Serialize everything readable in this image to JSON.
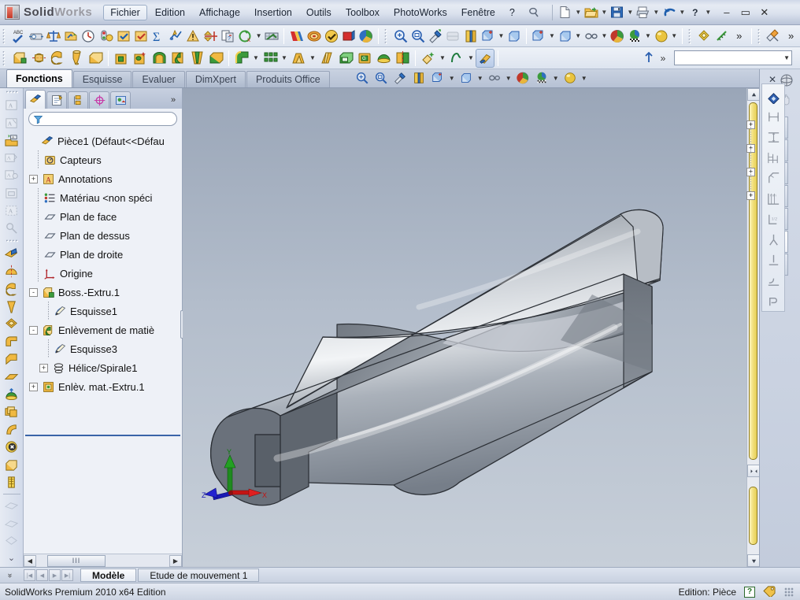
{
  "app": {
    "brand_main": "Solid",
    "brand_sub": "Works",
    "status_text": "SolidWorks Premium 2010 x64 Edition",
    "status_mode": "Edition: Pièce",
    "accent_color": "#c23a28",
    "viewport_bg_top": "#9aa6b8",
    "viewport_bg_bottom": "#c7cfd9"
  },
  "menu": {
    "items": [
      {
        "label": "Fichier",
        "boxed": true
      },
      {
        "label": "Edition",
        "boxed": false
      },
      {
        "label": "Affichage",
        "boxed": false
      },
      {
        "label": "Insertion",
        "boxed": false
      },
      {
        "label": "Outils",
        "boxed": false
      },
      {
        "label": "Toolbox",
        "boxed": false
      },
      {
        "label": "PhotoWorks",
        "boxed": false
      },
      {
        "label": "Fenêtre",
        "boxed": false
      },
      {
        "label": "?",
        "boxed": false
      }
    ],
    "pin_icon": "pin-icon",
    "quick_tools": [
      {
        "name": "new-document-icon",
        "caret": true
      },
      {
        "name": "open-folder-icon",
        "caret": true
      },
      {
        "name": "save-icon",
        "caret": true
      },
      {
        "name": "print-icon",
        "caret": true
      },
      {
        "name": "undo-icon",
        "caret": true
      },
      {
        "name": "help-question-icon",
        "caret": true
      }
    ],
    "window_controls": [
      {
        "name": "minimize-button",
        "glyph": "–"
      },
      {
        "name": "maximize-button",
        "glyph": "▭"
      },
      {
        "name": "close-button",
        "glyph": "✕"
      }
    ]
  },
  "toolbar_row1": {
    "icons": [
      {
        "name": "spell-checker-icon"
      },
      {
        "name": "measure-icon"
      },
      {
        "name": "mass-properties-icon"
      },
      {
        "name": "section-properties-icon"
      },
      {
        "name": "performance-evaluation-icon"
      },
      {
        "name": "sensor-icon"
      },
      {
        "name": "check-entity-icon"
      },
      {
        "name": "geometry-analysis-icon"
      },
      {
        "name": "equations-icon"
      },
      {
        "name": "statistics-icon"
      },
      {
        "name": "deviation-analysis-icon"
      },
      {
        "name": "symmetry-check-icon"
      },
      {
        "name": "compare-documents-icon"
      },
      {
        "name": "simulation-check-icon"
      },
      {
        "name": "curvature-display-icon"
      },
      {
        "name": "zebra-stripes-icon"
      },
      {
        "name": "draft-analysis-icon"
      },
      {
        "name": "undercut-detection-icon"
      },
      {
        "name": "parting-line-icon"
      },
      {
        "name": "zoom-to-fit-icon"
      },
      {
        "name": "zoom-to-area-icon"
      },
      {
        "name": "zoom-in-out-icon"
      },
      {
        "name": "previous-view-icon"
      },
      {
        "name": "section-view-icon"
      },
      {
        "name": "view-orientation-icon"
      },
      {
        "name": "display-style-icon"
      },
      {
        "name": "hide-show-items-icon"
      },
      {
        "name": "edit-appearance-icon"
      },
      {
        "name": "apply-scene-icon"
      },
      {
        "name": "view-settings-icon"
      },
      {
        "name": "real-view-graphics-icon"
      },
      {
        "name": "shadows-icon"
      },
      {
        "name": "overflow-chevron-icon"
      },
      {
        "name": "render-tools-icon"
      },
      {
        "name": "overflow-chevron2-icon"
      }
    ]
  },
  "toolbar_row2": {
    "icons": [
      {
        "name": "extruded-boss-icon"
      },
      {
        "name": "revolved-boss-icon"
      },
      {
        "name": "swept-boss-icon"
      },
      {
        "name": "lofted-boss-icon"
      },
      {
        "name": "boundary-boss-icon"
      },
      {
        "name": "extruded-cut-icon"
      },
      {
        "name": "wizard-hole-icon"
      },
      {
        "name": "revolved-cut-icon"
      },
      {
        "name": "swept-cut-icon"
      },
      {
        "name": "lofted-cut-icon"
      },
      {
        "name": "boundary-cut-icon"
      },
      {
        "name": "fillet-icon"
      },
      {
        "name": "linear-pattern-icon"
      },
      {
        "name": "rib-icon"
      },
      {
        "name": "draft-icon"
      },
      {
        "name": "shell-icon"
      },
      {
        "name": "wrap-icon"
      },
      {
        "name": "dome-icon"
      },
      {
        "name": "mirror-icon"
      },
      {
        "name": "reference-geometry-icon"
      },
      {
        "name": "curves-icon"
      },
      {
        "name": "instant3d-icon"
      }
    ],
    "search_placeholder": ""
  },
  "command_tabs": {
    "tabs": [
      {
        "label": "Fonctions",
        "active": true
      },
      {
        "label": "Esquisse",
        "active": false
      },
      {
        "label": "Evaluer",
        "active": false
      },
      {
        "label": "DimXpert",
        "active": false
      },
      {
        "label": "Produits Office",
        "active": false
      }
    ],
    "view_icons": [
      {
        "name": "zoom-to-fit-icon"
      },
      {
        "name": "zoom-to-area-icon"
      },
      {
        "name": "previous-view-icon"
      },
      {
        "name": "section-view-icon"
      },
      {
        "name": "view-orientation-icon"
      },
      {
        "name": "display-style-icon"
      },
      {
        "name": "hide-show-icon"
      },
      {
        "name": "edit-appearance-icon"
      },
      {
        "name": "apply-scene-icon"
      },
      {
        "name": "view-settings-icon"
      }
    ]
  },
  "tree_panel": {
    "tabs": [
      {
        "name": "feature-manager-tab",
        "label": "",
        "active": true
      },
      {
        "name": "property-manager-tab",
        "label": "",
        "active": false
      },
      {
        "name": "configuration-manager-tab",
        "label": "",
        "active": false
      },
      {
        "name": "dimxpert-manager-tab",
        "label": "",
        "active": false
      },
      {
        "name": "display-manager-tab",
        "label": "",
        "active": false
      }
    ],
    "more_tabs_glyph": "»",
    "filter_placeholder": "",
    "nodes": [
      {
        "label": "Pièce1  (Défaut<<Défau",
        "icon": "part-icon",
        "depth": 0,
        "expander": "none"
      },
      {
        "label": "Capteurs",
        "icon": "sensors-icon",
        "depth": 1,
        "expander": "none"
      },
      {
        "label": "Annotations",
        "icon": "annotations-icon",
        "depth": 1,
        "expander": "+"
      },
      {
        "label": "Matériau <non spéci",
        "icon": "material-icon",
        "depth": 1,
        "expander": "none"
      },
      {
        "label": "Plan de face",
        "icon": "plane-icon",
        "depth": 1,
        "expander": "none"
      },
      {
        "label": "Plan de dessus",
        "icon": "plane-icon",
        "depth": 1,
        "expander": "none"
      },
      {
        "label": "Plan de droite",
        "icon": "plane-icon",
        "depth": 1,
        "expander": "none"
      },
      {
        "label": "Origine",
        "icon": "origin-icon",
        "depth": 1,
        "expander": "none"
      },
      {
        "label": "Boss.-Extru.1",
        "icon": "extruded-boss-feature-icon",
        "depth": 1,
        "expander": "-"
      },
      {
        "label": "Esquisse1",
        "icon": "sketch-icon",
        "depth": 2,
        "expander": "none"
      },
      {
        "label": "Enlèvement de matiè",
        "icon": "swept-cut-feature-icon",
        "depth": 1,
        "expander": "-"
      },
      {
        "label": "Esquisse3",
        "icon": "sketch-icon",
        "depth": 2,
        "expander": "none"
      },
      {
        "label": "Hélice/Spirale1",
        "icon": "helix-spiral-icon",
        "depth": 2,
        "expander": "+"
      },
      {
        "label": "Enlèv. mat.-Extru.1",
        "icon": "extruded-cut-feature-icon",
        "depth": 1,
        "expander": "+"
      }
    ],
    "hscroll": {
      "left_glyph": "◀",
      "right_glyph": "▶",
      "thumb_glyph": "III"
    }
  },
  "right_pane": {
    "close_glyph": "✕",
    "tabs": [
      {
        "name": "solidworks-resources-tab",
        "icon": "home-icon"
      },
      {
        "name": "design-library-tab",
        "icon": "library-chart-icon"
      },
      {
        "name": "file-explorer-tab",
        "icon": "folder-icon"
      },
      {
        "name": "search-tab",
        "icon": "search-globe-icon"
      },
      {
        "name": "view-palette-tab",
        "icon": "palette-layout-icon"
      },
      {
        "name": "appearances-scenes-tab",
        "icon": "appearances-sphere-icon"
      },
      {
        "name": "custom-properties-tab",
        "icon": "custom-properties-icon"
      }
    ],
    "sketch_tools": [
      {
        "name": "smart-dimension-icon",
        "enabled": true
      },
      {
        "name": "horizontal-dimension-icon",
        "enabled": false
      },
      {
        "name": "vertical-dimension-icon",
        "enabled": false
      },
      {
        "name": "baseline-dimension-icon",
        "enabled": false
      },
      {
        "name": "ordinate-dimension-icon",
        "enabled": false
      },
      {
        "name": "chamfer-dimension-icon",
        "enabled": false
      },
      {
        "name": "path-length-dimension-icon",
        "enabled": false
      },
      {
        "name": "add-relation-icon",
        "enabled": false
      },
      {
        "name": "display-delete-relations-icon",
        "enabled": false
      },
      {
        "name": "fully-define-sketch-icon",
        "enabled": false
      },
      {
        "name": "repair-sketch-icon",
        "enabled": false
      }
    ]
  },
  "viewport": {
    "triad": {
      "x_label": "X",
      "y_label": "Y",
      "z_label": "Z",
      "x_color": "#d40000",
      "y_color": "#00a000",
      "z_color": "#0000cc"
    },
    "model_name": "helical-cut-cylinder",
    "scrollbar": {
      "up_glyph": "▲",
      "down_glyph": "▼",
      "left_glyph": "◀",
      "right_glyph": "▶"
    }
  },
  "bottom_bar": {
    "collapse_glyph": "»",
    "nav_buttons": [
      "⏮",
      "◀",
      "▶",
      "⏭"
    ],
    "tabs": [
      {
        "label": "Modèle",
        "active": true
      },
      {
        "label": "Etude de mouvement 1",
        "active": false
      }
    ]
  }
}
